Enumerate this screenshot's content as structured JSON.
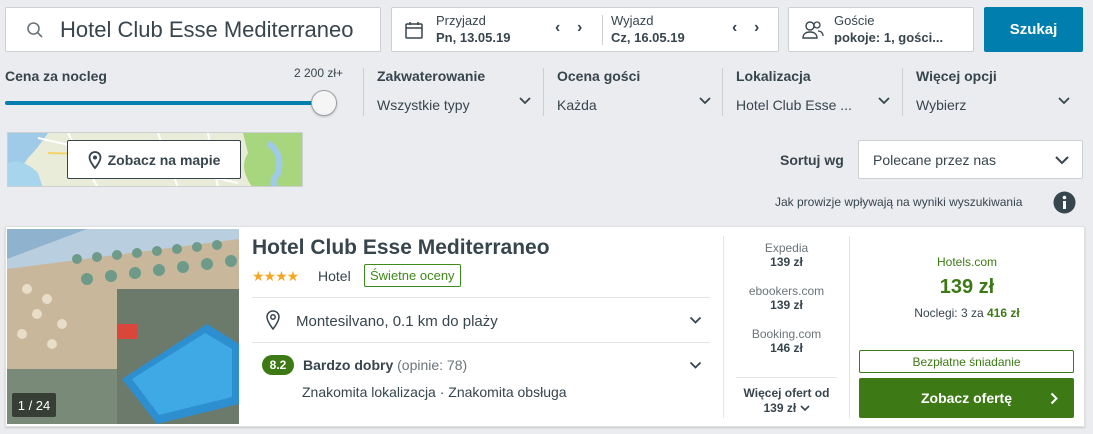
{
  "search": {
    "value": "Hotel Club Esse Mediterraneo"
  },
  "dates": {
    "checkin_label": "Przyjazd",
    "checkin_value": "Pn, 13.05.19",
    "checkout_label": "Wyjazd",
    "checkout_value": "Cz, 16.05.19"
  },
  "guests": {
    "label": "Goście",
    "value": "pokoje: 1, gości..."
  },
  "search_button": "Szukaj",
  "filters": {
    "price_label": "Cena za nocleg",
    "price_max": "2 200 zł+",
    "price_slider_level": 1.0,
    "accommodation_label": "Zakwaterowanie",
    "accommodation_value": "Wszystkie typy",
    "rating_label": "Ocena gości",
    "rating_value": "Każda",
    "location_label": "Lokalizacja",
    "location_value": "Hotel Club Esse ...",
    "more_label": "Więcej opcji",
    "more_value": "Wybierz"
  },
  "map": {
    "button": "Zobacz na mapie"
  },
  "sort": {
    "label": "Sortuj wg",
    "value": "Polecane przez nas"
  },
  "disclaimer": "Jak prowizje wpływają na wyniki wyszukiwania",
  "hotel": {
    "name": "Hotel Club Esse Mediterraneo",
    "stars": "★★★★",
    "type": "Hotel",
    "badge": "Świetne oceny",
    "location": "Montesilvano, 0.1 km do plaży",
    "score": "8.2",
    "rating_word": "Bardzo dobry",
    "rating_count": "(opinie: 78)",
    "highlights": "Znakomita lokalizacja · Znakomita obsługa",
    "photo_counter": "1 / 24"
  },
  "offers": [
    {
      "provider": "Expedia",
      "price": "139 zł"
    },
    {
      "provider": "ebookers.com",
      "price": "139 zł"
    },
    {
      "provider": "Booking.com",
      "price": "146 zł"
    }
  ],
  "more_offers": {
    "label": "Więcej ofert od",
    "price": "139 zł"
  },
  "best_offer": {
    "provider": "Hotels.com",
    "price": "139 zł",
    "nights_prefix": "Noclegi: 3 za",
    "nights_total": "416 zł",
    "perk": "Bezpłatne śniadanie",
    "cta": "Zobacz ofertę"
  },
  "colors": {
    "accent": "#007faf",
    "green": "#3d7a16",
    "star": "#f5a623"
  }
}
